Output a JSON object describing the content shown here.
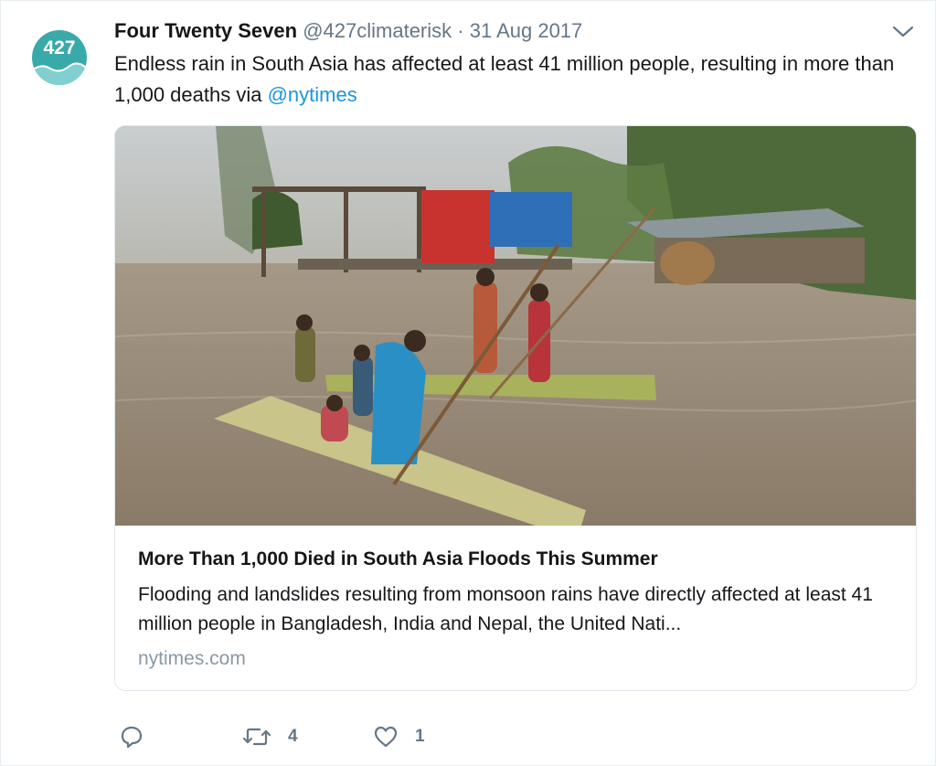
{
  "tweet": {
    "avatar_text": "427",
    "display_name": "Four Twenty Seven",
    "handle": "@427climaterisk",
    "separator": " · ",
    "date": "31 Aug 2017",
    "text_main": "Endless rain in South Asia has affected at least 41 million people, resulting in more than 1,000 deaths via ",
    "mention": "@nytimes"
  },
  "icons": {
    "more": "chevron-down-icon",
    "reply": "reply-icon",
    "retweet": "retweet-icon",
    "like": "heart-icon"
  },
  "card": {
    "title": "More Than 1,000 Died in South Asia Floods This Summer",
    "description": "Flooding and landslides resulting from monsoon rains have directly affected at least 41 million people in Bangladesh, India and Nepal, the United Nati...",
    "domain": "nytimes.com"
  },
  "actions": {
    "retweet_count": "4",
    "like_count": "1"
  },
  "colors": {
    "link": "#1b95e0",
    "muted": "#657786",
    "avatar": "#3aa9a9"
  }
}
